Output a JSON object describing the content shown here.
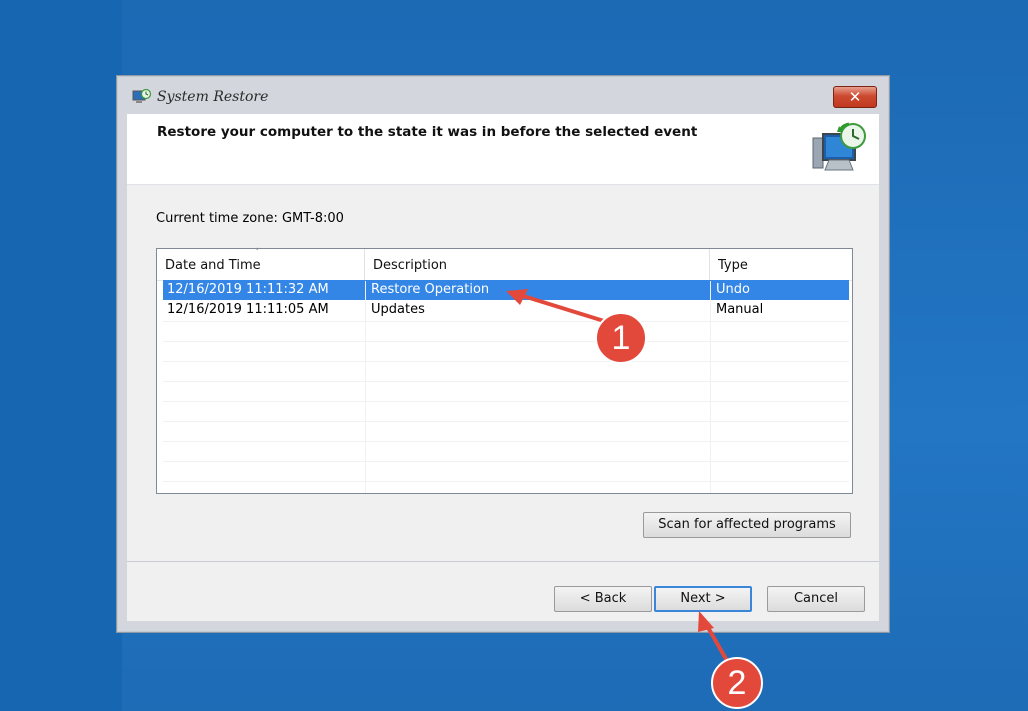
{
  "window": {
    "title": "System Restore",
    "close_label": "✕"
  },
  "header": {
    "heading": "Restore your computer to the state it was in before the selected event"
  },
  "timezone_label": "Current time zone: GMT-8:00",
  "table": {
    "columns": [
      "Date and Time",
      "Description",
      "Type"
    ],
    "sort_indicator": "˅",
    "rows": [
      {
        "date": "12/16/2019 11:11:32 AM",
        "description": "Restore Operation",
        "type": "Undo",
        "selected": true
      },
      {
        "date": "12/16/2019 11:11:05 AM",
        "description": "Updates",
        "type": "Manual",
        "selected": false
      }
    ]
  },
  "scan_button": "Scan for affected programs",
  "footer": {
    "back": "< Back",
    "next": "Next >",
    "cancel": "Cancel"
  },
  "annotations": {
    "badge_1": "1",
    "badge_2": "2",
    "color": "#e3493b"
  },
  "colors": {
    "desktop": "#1f6db8",
    "selection": "#3385e6"
  }
}
